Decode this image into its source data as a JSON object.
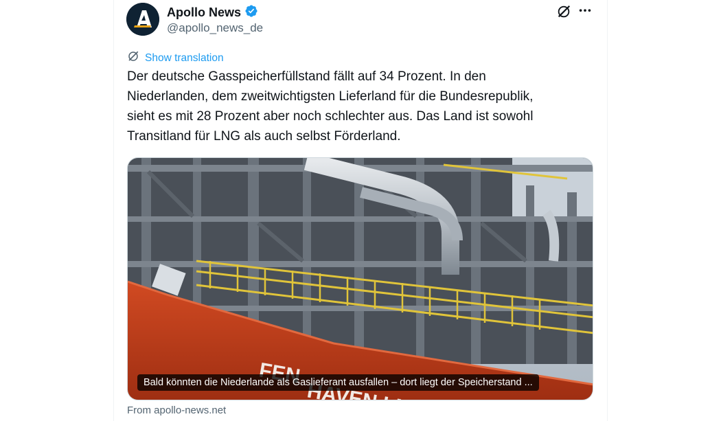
{
  "author": {
    "display_name": "Apollo News",
    "handle": "@apollo_news_de",
    "verified": true,
    "avatar_letter": "A"
  },
  "icons": {
    "grok": "grok-icon",
    "more": "more-options-icon",
    "translate": "translate-icon",
    "verified": "verified-badge-icon"
  },
  "translation": {
    "label": "Show translation"
  },
  "tweet": {
    "lines": [
      "Der deutsche Gasspeicherfüllstand fällt auf 34 Prozent. In den",
      "Niederlanden, dem zweitwichtigsten Lieferland für die Bundesrepublik,",
      "sieht es mit 28 Prozent aber noch schlechter aus. Das Land ist sowohl",
      "Transitland für LNG als auch selbst Förderland."
    ]
  },
  "card": {
    "caption": "Bald könnten die Niederlande als Gaslieferant ausfallen – dort liegt der Speicherstand ...",
    "source": "From apollo-news.net"
  },
  "colors": {
    "accent": "#1d9bf0",
    "text": "#0f1419",
    "secondary": "#536471",
    "ship_hull": "#c9401f"
  }
}
